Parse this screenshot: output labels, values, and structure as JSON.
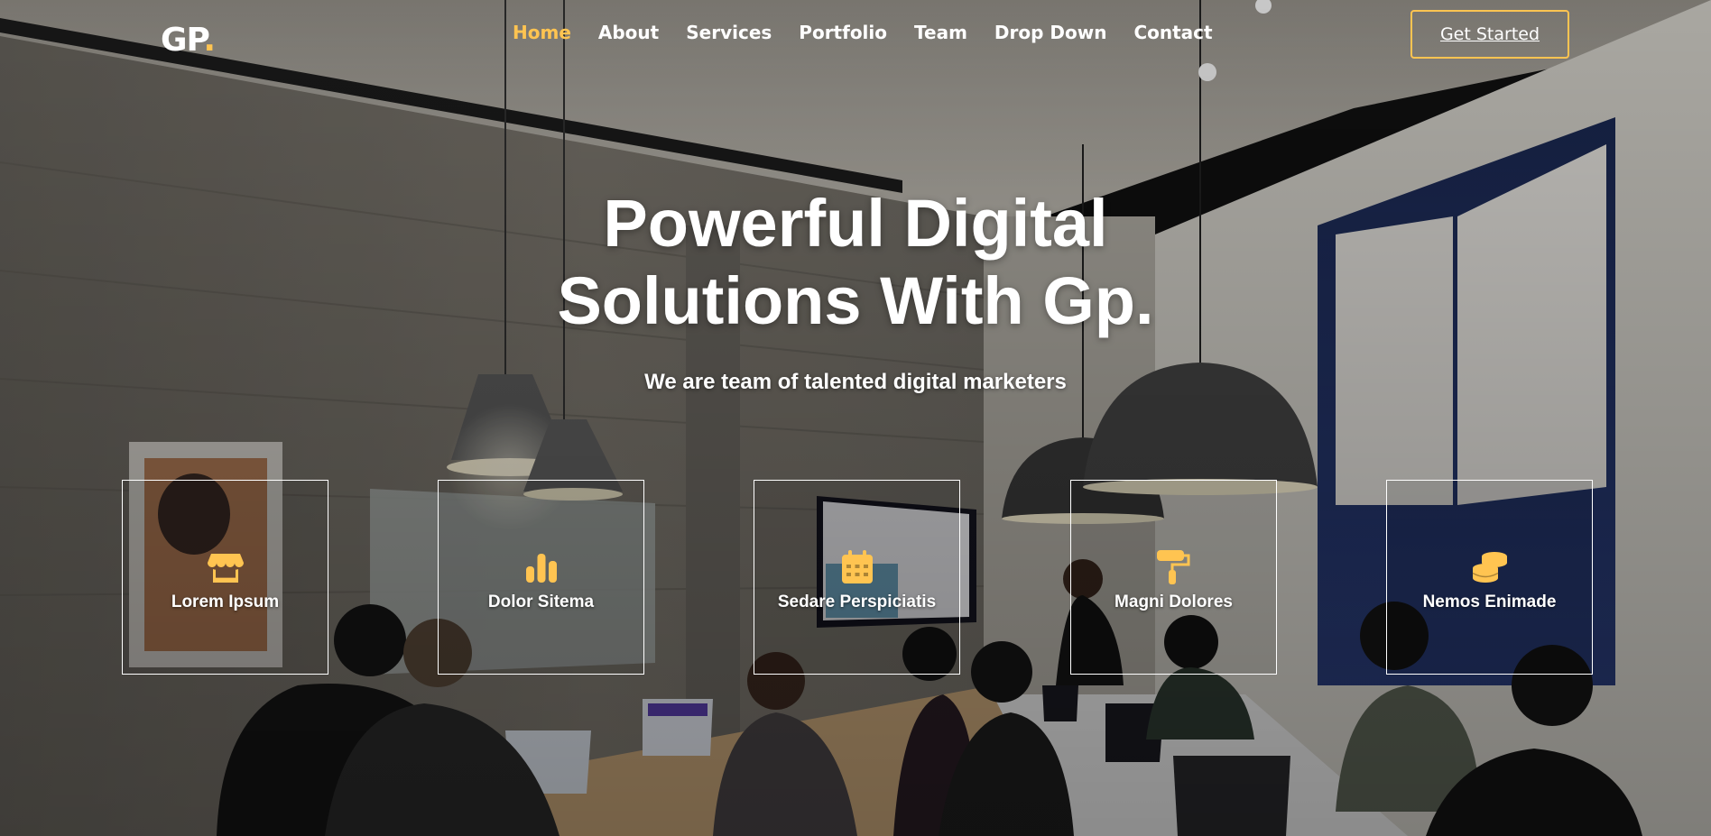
{
  "header": {
    "logo_text": "GP",
    "logo_dot": ".",
    "nav": [
      {
        "label": "Home",
        "active": true
      },
      {
        "label": "About"
      },
      {
        "label": "Services"
      },
      {
        "label": "Portfolio"
      },
      {
        "label": "Team"
      },
      {
        "label": "Drop Down"
      },
      {
        "label": "Contact"
      }
    ],
    "cta_label": "Get Started"
  },
  "hero": {
    "title_line1": "Powerful Digital",
    "title_line2": "Solutions With Gp.",
    "subtitle": "We are team of talented digital marketers"
  },
  "features": [
    {
      "label": "Lorem Ipsum",
      "icon": "store-icon"
    },
    {
      "label": "Dolor Sitema",
      "icon": "bar-chart-icon"
    },
    {
      "label": "Sedare Perspiciatis",
      "icon": "calendar-icon"
    },
    {
      "label": "Magni Dolores",
      "icon": "paint-roller-icon"
    },
    {
      "label": "Nemos Enimade",
      "icon": "database-icon"
    }
  ],
  "colors": {
    "accent": "#ffc451",
    "text": "#ffffff"
  }
}
